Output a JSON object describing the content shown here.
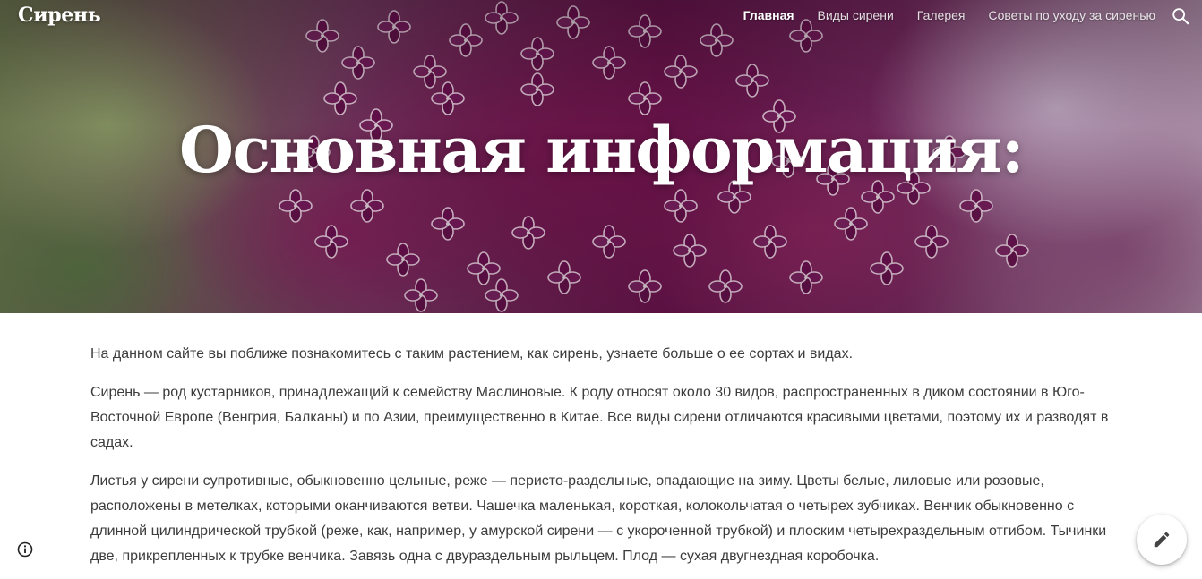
{
  "site": {
    "title": "Сирень"
  },
  "nav": {
    "items": [
      {
        "label": "Главная",
        "active": true
      },
      {
        "label": "Виды сирени",
        "active": false
      },
      {
        "label": "Галерея",
        "active": false
      },
      {
        "label": "Советы по уходу за сиренью",
        "active": false
      }
    ],
    "search_icon": "search-icon"
  },
  "hero": {
    "heading": "Основная информация:"
  },
  "content": {
    "paragraphs": [
      "На данном сайте вы поближе познакомитесь с таким растением, как сирень, узнаете больше о ее сортах и видах.",
      "Сирень — род кустарников, принадлежащий к семейству Маслиновые. К роду относят около 30 видов, распространенных в диком состоянии в Юго-Восточной Европе (Венгрия, Балканы) и по Азии, преимущественно в Китае. Все виды сирени отличаются красивыми цветами, поэтому их и разводят в садах.",
      "Листья у сирени супротивные, обыкновенно цельные, реже — перисто-раздельные, опадающие на зиму. Цветы белые, лиловые или розовые, расположены в метелках, которыми оканчиваются ветви. Чашечка маленькая, короткая, колокольчатая о четырех зубчиках. Венчик обыкновенно с длинной цилиндрической трубкой (реже, как, например, у амурской сирени — с укороченной трубкой) и плоским четырехраздельным отгибом. Тычинки две, прикрепленных к трубке венчика. Завязь одна с двураздельным рыльцем. Плод — сухая двугнездная коробочка."
    ]
  },
  "floating": {
    "info_icon": "info-icon",
    "edit_icon": "pencil-icon"
  },
  "colors": {
    "text": "#3c3c3c",
    "hero_text": "#ffffff",
    "lilac": "#7a1a5e"
  }
}
